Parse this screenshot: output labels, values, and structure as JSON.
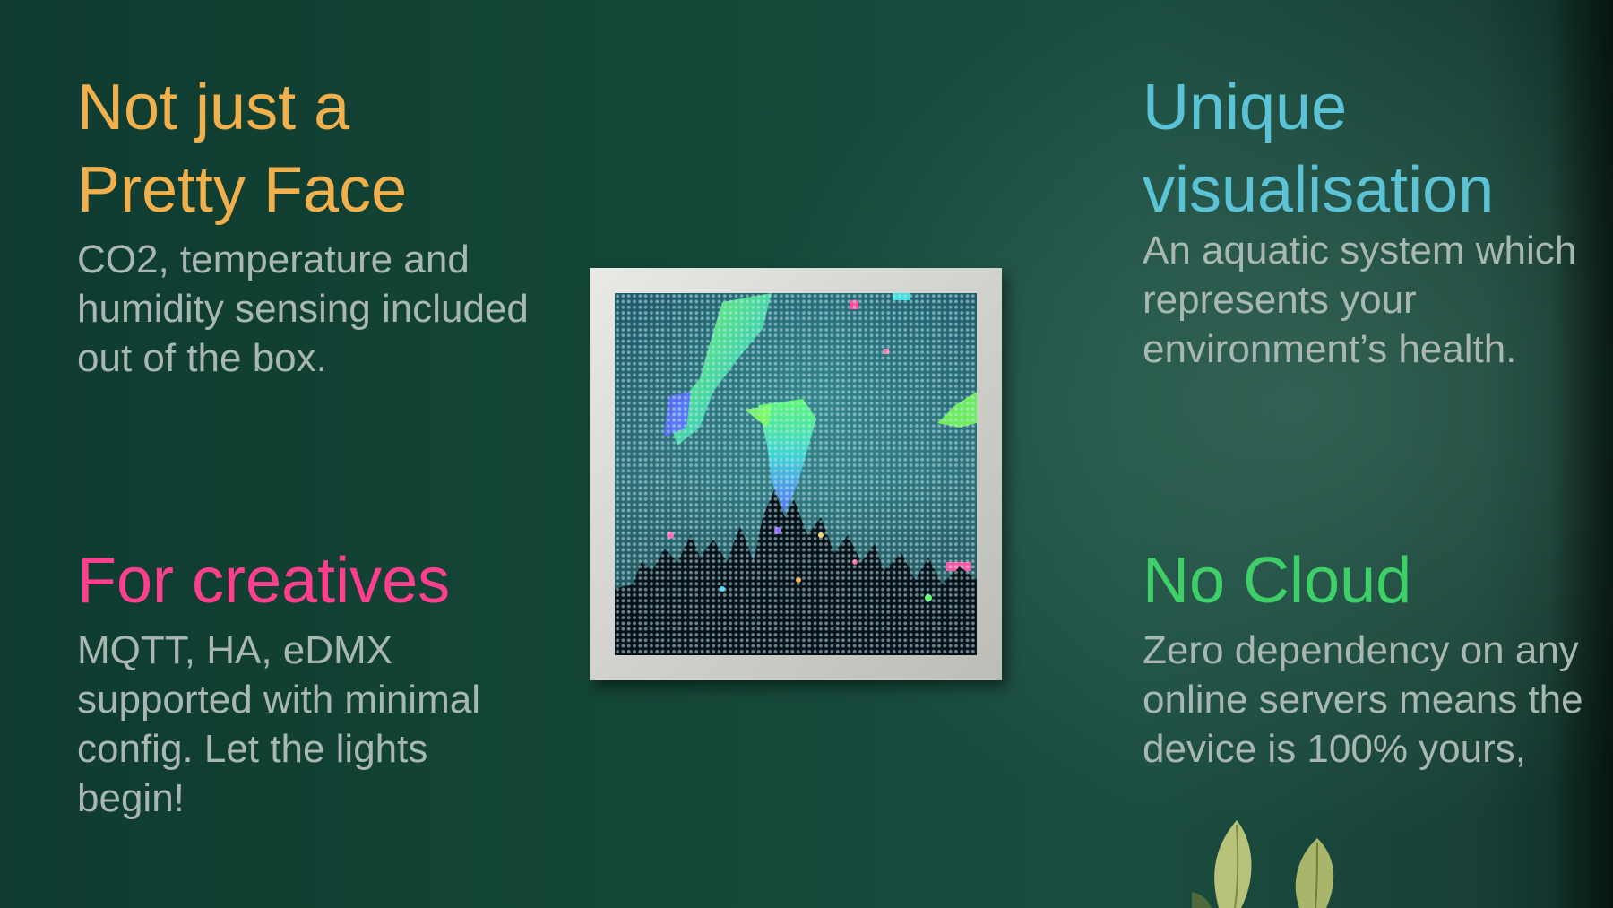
{
  "features": [
    {
      "heading_line1": "Not just a",
      "heading_line2": "Pretty Face",
      "description": "CO2, temperature and humidity sensing included out of the box."
    },
    {
      "heading_line1": "Unique",
      "heading_line2": "visualisation",
      "description": "An aquatic system which represents your environment’s health."
    },
    {
      "heading_line1": "For creatives",
      "description": "MQTT, HA, eDMX supported with minimal config. Let the lights begin!"
    },
    {
      "heading_line1": "No Cloud",
      "description": "Zero dependency on any online servers means the device is 100% yours,"
    }
  ],
  "colors": {
    "background": "#134536",
    "pretty_face": "#f2b04d",
    "visualisation": "#5cc3d6",
    "creatives": "#ff3f8e",
    "no_cloud": "#3ecf68",
    "body_text": "#a9b7b2"
  },
  "icons": [
    "led-matrix-frame",
    "plant-leaves"
  ]
}
